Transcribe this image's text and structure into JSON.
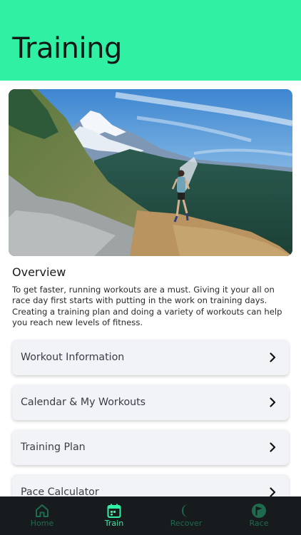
{
  "header": {
    "title": "Training"
  },
  "overview": {
    "title": "Overview",
    "text": "To get faster, running workouts are a must. Giving it your all on race day first starts with putting in the work on training days. Creating a training plan and doing a variety of workouts can help you reach new levels of fitness."
  },
  "menu": {
    "items": [
      {
        "label": "Workout Information",
        "icon": "chevron-right-icon"
      },
      {
        "label": "Calendar & My Workouts",
        "icon": "chevron-right-icon"
      },
      {
        "label": "Training Plan",
        "icon": "chevron-right-icon"
      },
      {
        "label": "Pace Calculator",
        "icon": "chevron-right-icon"
      }
    ]
  },
  "tabbar": {
    "active": "Train",
    "tabs": [
      {
        "label": "Home",
        "icon": "home-icon"
      },
      {
        "label": "Train",
        "icon": "calendar-icon"
      },
      {
        "label": "Recover",
        "icon": "moon-icon"
      },
      {
        "label": "Race",
        "icon": "flag-icon"
      }
    ]
  },
  "colors": {
    "accent": "#2ff0a3",
    "tabbar_bg": "#171b1e",
    "tab_inactive": "#1f6b4d",
    "card_bg": "#f1f3f7"
  }
}
